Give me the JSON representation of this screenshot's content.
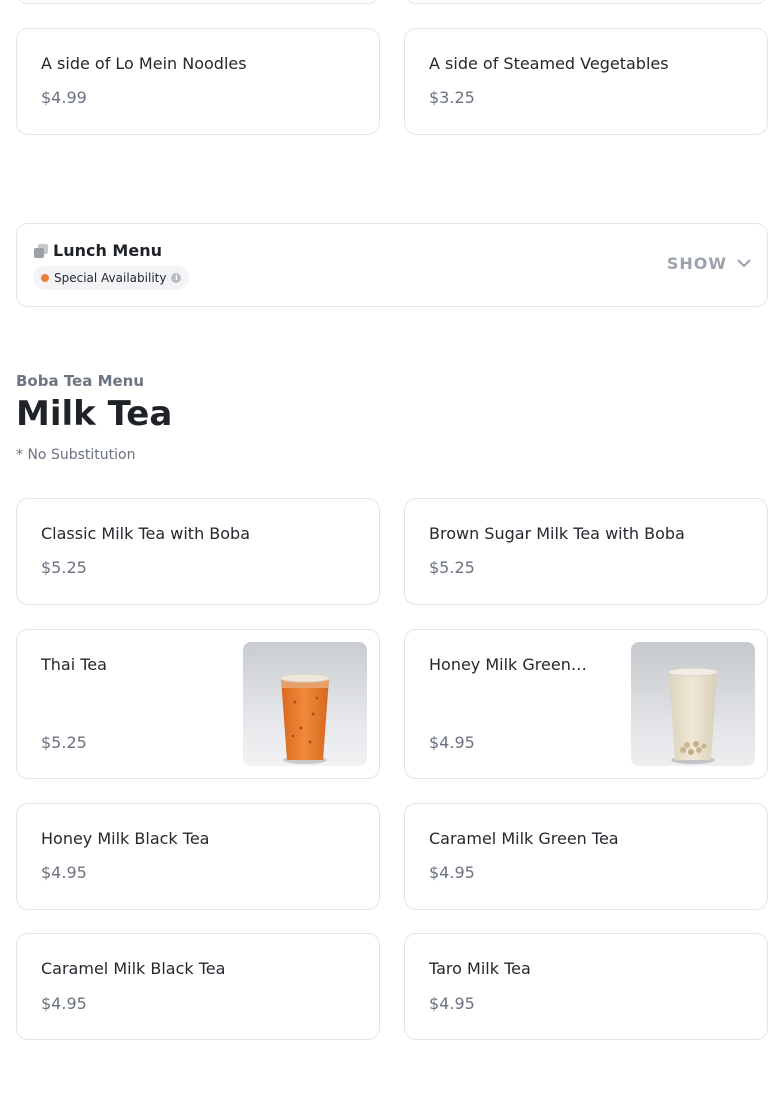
{
  "top_items": [
    {
      "name": "A side of Lo Mein Noodles",
      "price": "$4.99"
    },
    {
      "name": "A side of Steamed Vegetables",
      "price": "$3.25"
    }
  ],
  "lunch_menu": {
    "title": "Lunch Menu",
    "badge": "Special Availability",
    "toggle": "SHOW",
    "dot_color": "#f07b3f"
  },
  "section": {
    "eyebrow": "Boba Tea Menu",
    "title": "Milk Tea",
    "note": "* No Substitution"
  },
  "items": [
    {
      "name": "Classic Milk Tea with Boba",
      "price": "$5.25"
    },
    {
      "name": "Brown Sugar Milk Tea with Boba",
      "price": "$5.25"
    },
    {
      "name": "Thai Tea",
      "price": "$5.25",
      "image": "thai-tea-photo"
    },
    {
      "name": "Honey Milk Green…",
      "price": "$4.95",
      "image": "honey-milk-green-tea-photo"
    },
    {
      "name": "Honey Milk Black Tea",
      "price": "$4.95"
    },
    {
      "name": "Caramel Milk Green Tea",
      "price": "$4.95"
    },
    {
      "name": "Caramel Milk Black Tea",
      "price": "$4.95"
    },
    {
      "name": "Taro Milk Tea",
      "price": "$4.95"
    }
  ]
}
